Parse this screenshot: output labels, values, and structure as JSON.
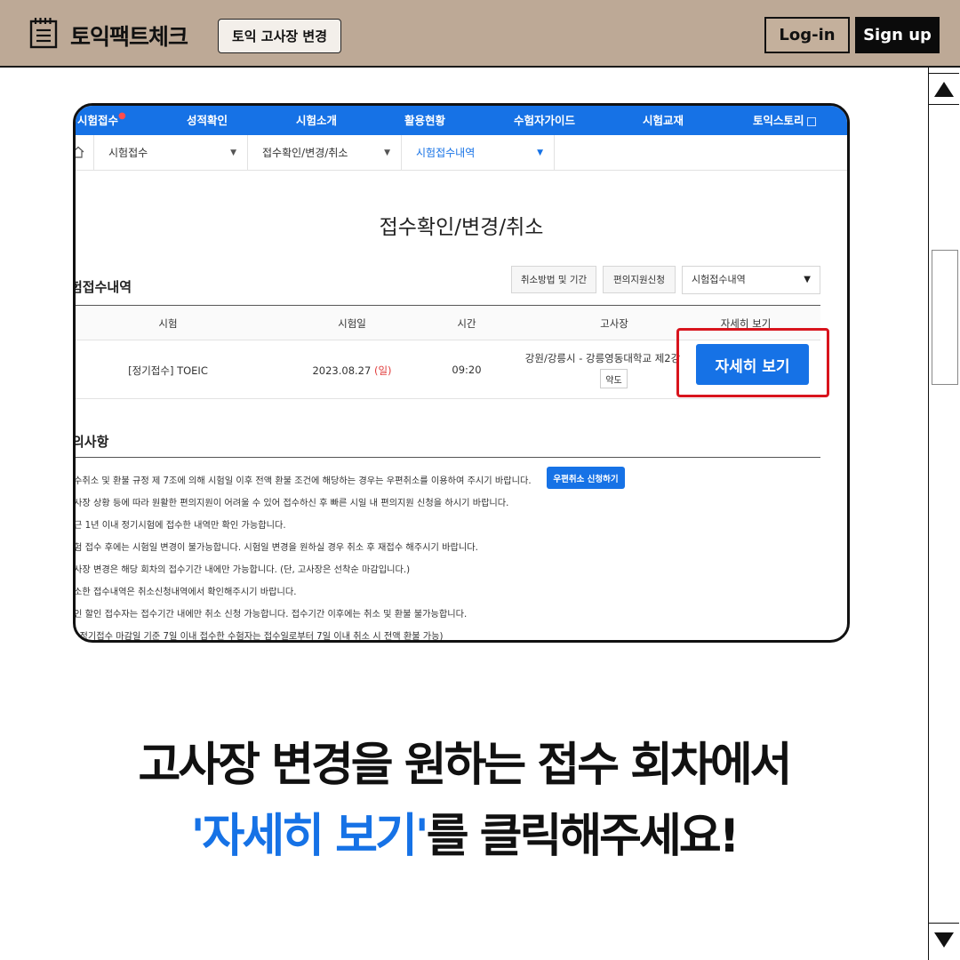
{
  "header": {
    "brand": "토익팩트체크",
    "change_button": "토익 고사장 변경",
    "login_button": "Log-in",
    "signup_button": "Sign up",
    "bg_color": "#bda996"
  },
  "screenshot": {
    "nav": {
      "items": [
        "시험접수",
        "성적확인",
        "시험소개",
        "활용현황",
        "수험자가이드",
        "시험교재",
        "토익스토리"
      ],
      "accent": "#1672e6"
    },
    "subnav": {
      "items": [
        "시험접수",
        "접수확인/변경/취소",
        "시험접수내역"
      ]
    },
    "page_title": "접수확인/변경/취소",
    "section_title": "험접수내역",
    "buttons": {
      "cancel_method": "취소방법 및 기간",
      "convenience": "편의지원신청"
    },
    "select_value": "시험접수내역",
    "table": {
      "headers": [
        "시험",
        "시험일",
        "시간",
        "고사장",
        "자세히 보기"
      ],
      "row": {
        "exam": "[정기접수] TOEIC",
        "date": "2023.08.27",
        "day": "(일)",
        "time": "09:20",
        "venue": "강원/강릉시 - 강릉영동대학교 제2강",
        "map_button": "약도",
        "detail_button": "자세히 보기"
      }
    },
    "notice": {
      "title": "의사항",
      "lines": [
        "수취소 및 환불 규정 제 7조에 의해 시험일 이후 전액 환불 조건에 해당하는 경우는 우편취소를 이용하여 주시기 바랍니다.",
        "사장 상황 등에 따라 원활한 편의지원이 어려울 수 있어 접수하신 후 빠른 시일 내 편의지원 신청을 하시기 바랍니다.",
        "근 1년 이내 정기시험에 접수한 내역만 확인 가능합니다.",
        "험 접수 후에는 시험일 변경이 불가능합니다. 시험일 변경을 원하실 경우 취소 후 재접수 해주시기 바랍니다.",
        "사장 변경은 해당 회차의 접수기간 내에만 가능합니다. (단, 고사장은 선착순 마감입니다.)",
        "소한 접수내역은 취소신청내역에서 확인해주시기 바랍니다.",
        "인 할인 접수자는 접수기간 내에만 취소 신청 가능합니다. 접수기간 이후에는 취소 및 환불 불가능합니다.",
        "· 정기접수 마감일 기준 7일 이내 접수한 수험자는 접수일로부터 7일 이내 취소 시 전액 환불 가능)"
      ],
      "mail_cancel_button": "우편취소 신청하기"
    }
  },
  "caption": {
    "line1": "고사장 변경을 원하는 접수 회차에서",
    "line2_highlight": "'자세히 보기'",
    "line2_rest": "를 클릭해주세요!",
    "highlight_color": "#1672e6"
  }
}
